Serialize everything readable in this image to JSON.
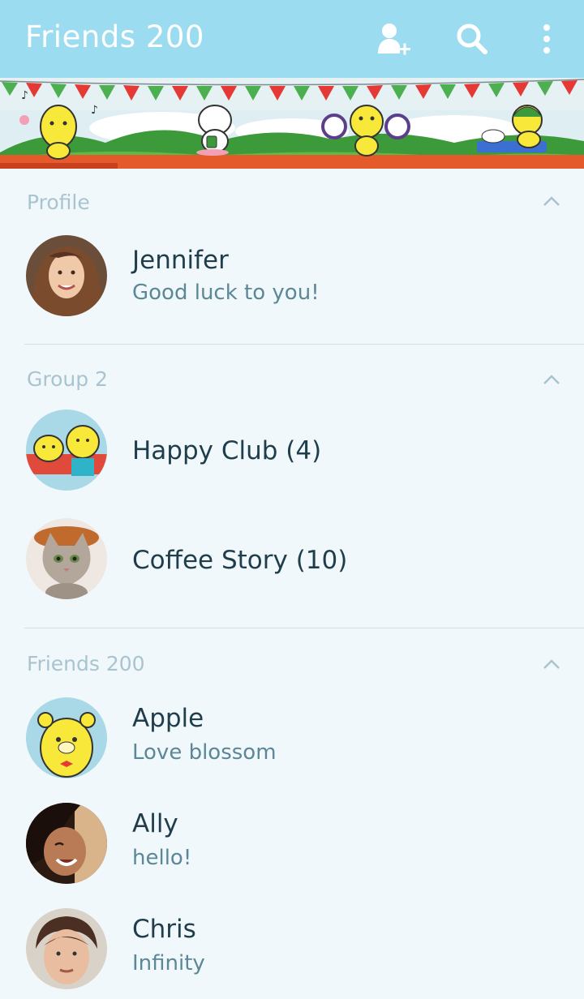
{
  "appbar": {
    "title": "Friends 200",
    "icons": [
      "add-friend-icon",
      "search-icon",
      "more-vert-icon"
    ],
    "background": "#9cdcf0"
  },
  "sections": {
    "profile": {
      "header": "Profile"
    },
    "groups": {
      "header": "Group 2"
    },
    "friends": {
      "header": "Friends 200"
    }
  },
  "profile": {
    "name": "Jennifer",
    "status": "Good luck to you!"
  },
  "groups": [
    {
      "name": "Happy Club (4)"
    },
    {
      "name": "Coffee Story (10)"
    }
  ],
  "friends": [
    {
      "name": "Apple",
      "status": "Love blossom"
    },
    {
      "name": "Ally",
      "status": "hello!"
    },
    {
      "name": "Chris",
      "status": "Infinity"
    }
  ],
  "colors": {
    "accent": "#9cdcf0",
    "name_text": "#1f3d4a",
    "status_text": "#5b8796",
    "section_header": "#a9c4cf"
  }
}
